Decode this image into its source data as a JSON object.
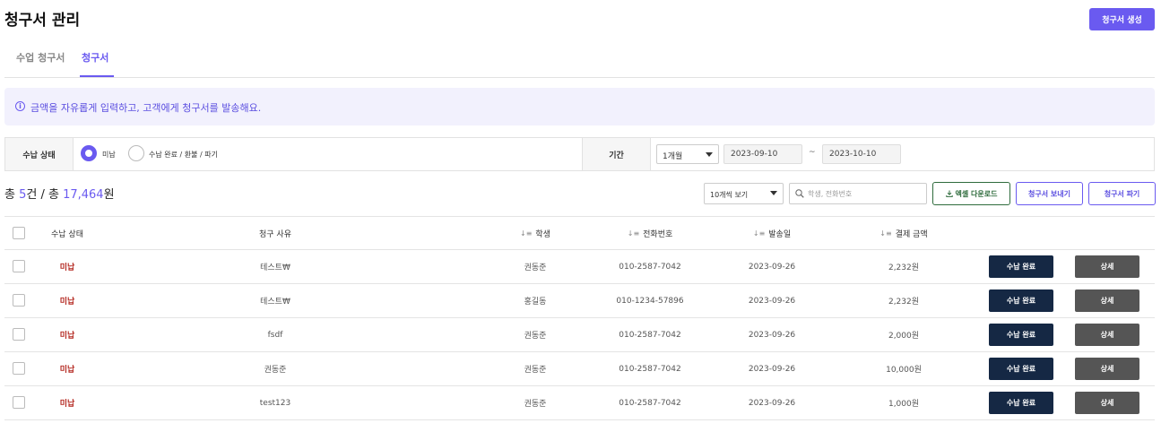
{
  "page": {
    "title": "청구서 관리",
    "create_button": "청구서 생성"
  },
  "tabs": [
    {
      "label": "수업 청구서",
      "active": false
    },
    {
      "label": "청구서",
      "active": true
    }
  ],
  "notice": {
    "text": "금액을 자유롭게 입력하고, 고객에게 청구서를 발송해요."
  },
  "filter": {
    "status_label": "수납 상태",
    "status_options": [
      {
        "label": "미납",
        "selected": true
      },
      {
        "label": "수납 완료 / 환불 / 파기",
        "selected": false
      }
    ],
    "period_label": "기간",
    "period_value": "1개월",
    "date_from": "2023-09-10",
    "date_separator": "~",
    "date_to": "2023-10-10"
  },
  "summary": {
    "prefix": "총 ",
    "count": "5",
    "count_suffix": "건 / 총 ",
    "amount": "17,464",
    "amount_suffix": "원"
  },
  "toolbar": {
    "per_page": "10개씩 보기",
    "search_placeholder": "학생, 전화번호",
    "excel_button": "엑셀 다운로드",
    "send_button": "청구서 보내기",
    "void_button": "청구서 파기"
  },
  "table": {
    "headers": {
      "status": "수납 상태",
      "reason": "청구 사유",
      "student": "학생",
      "phone": "전화번호",
      "sent_date": "발송일",
      "amount": "결제 금액"
    },
    "sort_glyph": "↓≡",
    "paid_button": "수납 완료",
    "detail_button": "상세",
    "rows": [
      {
        "status": "미납",
        "reason": "테스트₩",
        "student": "권동준",
        "phone": "010-2587-7042",
        "sent_date": "2023-09-26",
        "amount": "2,232원"
      },
      {
        "status": "미납",
        "reason": "테스트₩",
        "student": "홍길동",
        "phone": "010-1234-57896",
        "sent_date": "2023-09-26",
        "amount": "2,232원"
      },
      {
        "status": "미납",
        "reason": "fsdf",
        "student": "권동준",
        "phone": "010-2587-7042",
        "sent_date": "2023-09-26",
        "amount": "2,000원"
      },
      {
        "status": "미납",
        "reason": "권동준",
        "student": "권동준",
        "phone": "010-2587-7042",
        "sent_date": "2023-09-26",
        "amount": "10,000원"
      },
      {
        "status": "미납",
        "reason": "test123",
        "student": "권동준",
        "phone": "010-2587-7042",
        "sent_date": "2023-09-26",
        "amount": "1,000원"
      }
    ]
  },
  "colors": {
    "accent": "#6a5af0",
    "unpaid": "#b3261e",
    "paid_button": "#152844",
    "detail_button": "#555555",
    "excel": "#2e6b3c"
  }
}
